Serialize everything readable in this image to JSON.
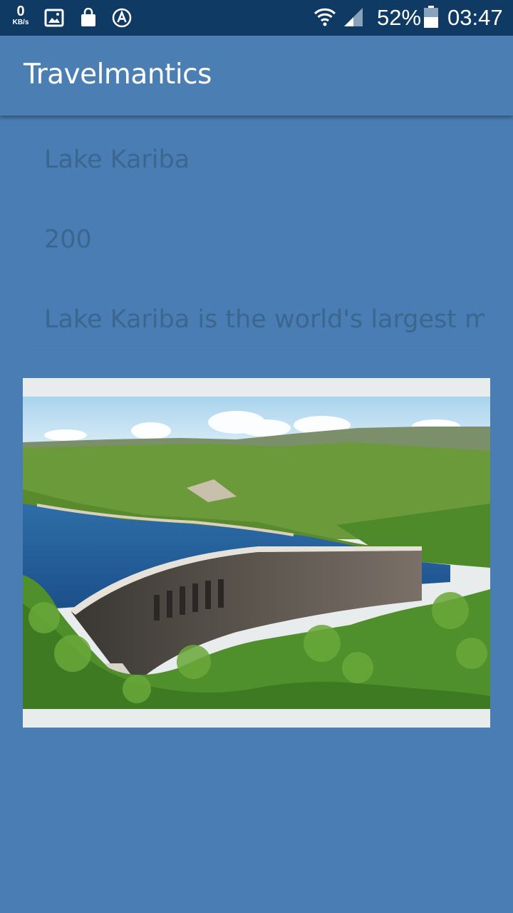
{
  "status_bar": {
    "net_speed_value": "0",
    "net_speed_unit": "KB/s",
    "battery_percent": "52%",
    "time": "03:47",
    "icons": [
      "image-icon",
      "shopping-bag-icon",
      "auto-a-icon",
      "wifi-icon",
      "cell-signal-icon",
      "battery-icon"
    ]
  },
  "app_bar": {
    "title": "Travelmantics"
  },
  "form": {
    "title_value": "Lake Kariba",
    "price_value": "200",
    "description_value": "Lake Kariba is the world's largest man-made lake"
  },
  "colors": {
    "status_bar": "#0f3a63",
    "app_bar": "#4b7eb2",
    "background": "#4a7db3",
    "field_text": "#3a6690"
  },
  "image": {
    "icon": "kariba-dam-photo"
  }
}
